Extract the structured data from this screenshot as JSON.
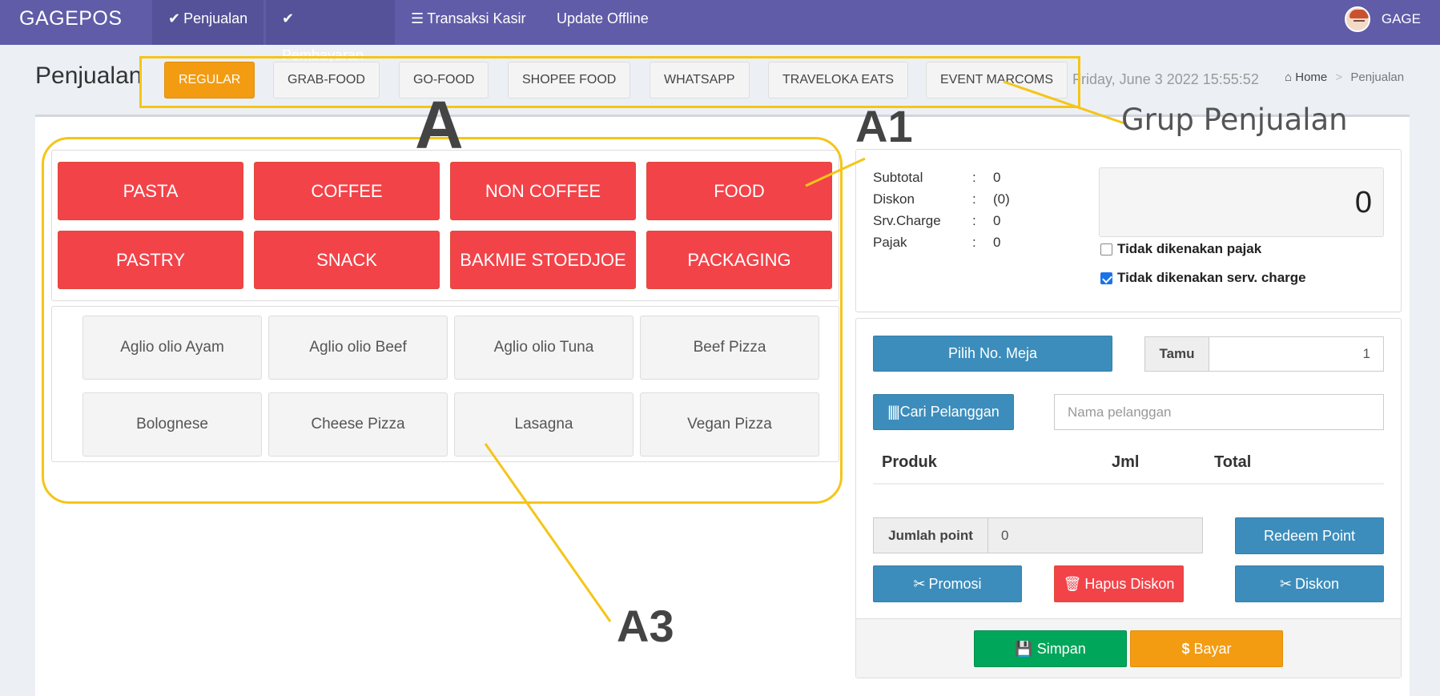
{
  "navbar": {
    "brand": "GAGEPOS",
    "items": [
      {
        "label": "Penjualan",
        "icon": "check-icon"
      },
      {
        "label": "Pembayaran",
        "icon": "check-icon"
      },
      {
        "label": "Transaksi Kasir",
        "icon": "list-icon"
      },
      {
        "label": "Update Offline",
        "icon": ""
      }
    ],
    "user": "GAGE"
  },
  "header": {
    "title": "Penjualan",
    "groups": [
      "REGULAR",
      "GRAB-FOOD",
      "GO-FOOD",
      "SHOPEE FOOD",
      "WHATSAPP",
      "TRAVELOKA EATS",
      "EVENT MARCOMS"
    ],
    "active_group": "REGULAR",
    "datetime": "Friday, June 3 2022 15:55:52",
    "breadcrumb": {
      "home": "Home",
      "current": "Penjualan"
    }
  },
  "categories": [
    "PASTA",
    "COFFEE",
    "NON COFFEE",
    "FOOD",
    "PASTRY",
    "SNACK",
    "BAKMIE STOEDJOE",
    "PACKAGING"
  ],
  "products": [
    "Aglio olio Ayam",
    "Aglio olio Beef",
    "Aglio olio Tuna",
    "Beef Pizza",
    "Bolognese",
    "Cheese Pizza",
    "Lasagna",
    "Vegan Pizza"
  ],
  "summary": {
    "rows": [
      {
        "label": "Subtotal",
        "colon": ":",
        "value": "0"
      },
      {
        "label": "Diskon",
        "colon": ":",
        "value": "(0)"
      },
      {
        "label": "Srv.Charge",
        "colon": ":",
        "value": "0"
      },
      {
        "label": "Pajak",
        "colon": ":",
        "value": "0"
      }
    ],
    "total": "0",
    "no_tax_label": "Tidak dikenakan pajak",
    "no_tax_checked": false,
    "no_service_label": "Tidak dikenakan serv. charge",
    "no_service_checked": true
  },
  "order": {
    "table_button": "Pilih No. Meja",
    "guest_label": "Tamu",
    "guest_value": "1",
    "find_customer_button": "Cari Pelanggan",
    "customer_placeholder": "Nama pelanggan",
    "columns": [
      "Produk",
      "Jml",
      "Total"
    ],
    "points_label": "Jumlah point",
    "points_value": "0",
    "redeem_button": "Redeem Point",
    "promo_button": "Promosi",
    "remove_discount_button": "Hapus Diskon",
    "discount_button": "Diskon",
    "save_button": "Simpan",
    "pay_button": "Bayar"
  },
  "annotations": {
    "group_label": "Grup Penjualan",
    "a": "A",
    "a1": "A1",
    "a3": "A3",
    "color": "#f5c518"
  }
}
